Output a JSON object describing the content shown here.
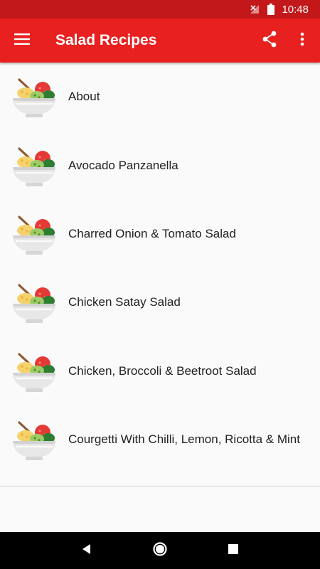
{
  "status_bar": {
    "time": "10:48"
  },
  "app_bar": {
    "title": "Salad Recipes",
    "menu_icon": "hamburger-menu-icon",
    "share_icon": "share-icon",
    "overflow_icon": "more-vert-icon"
  },
  "recipes": [
    {
      "label": "About"
    },
    {
      "label": "Avocado Panzanella"
    },
    {
      "label": "Charred Onion & Tomato Salad"
    },
    {
      "label": "Chicken Satay Salad"
    },
    {
      "label": "Chicken, Broccoli & Beetroot Salad"
    },
    {
      "label": "Courgetti With Chilli, Lemon, Ricotta & Mint"
    }
  ],
  "colors": {
    "status_bar": "#c2181a",
    "app_bar": "#e8201f",
    "background": "#fafafa",
    "text": "#212121"
  }
}
